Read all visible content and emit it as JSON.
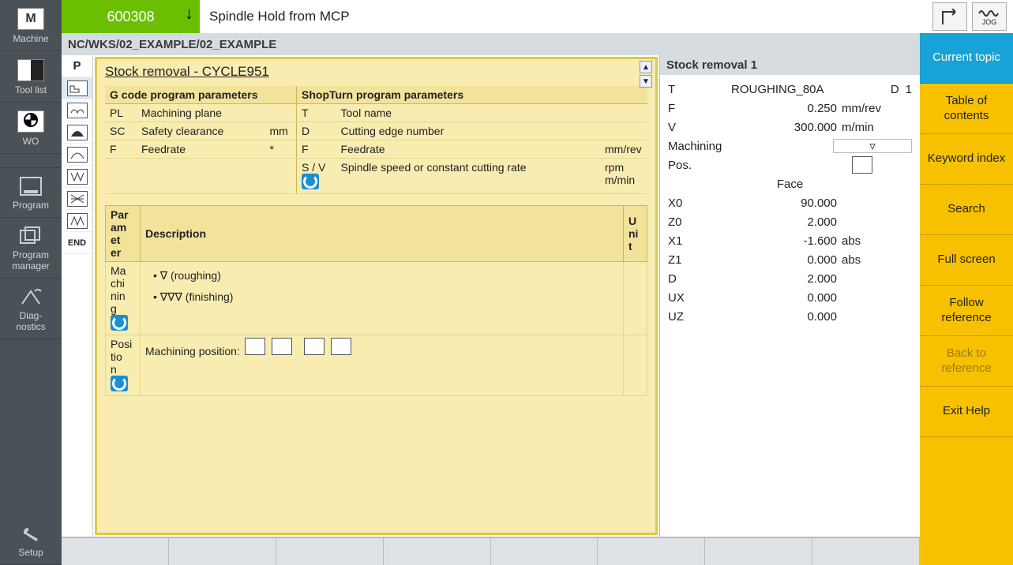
{
  "left_sidebar": {
    "machine": "Machine",
    "toollist": "Tool list",
    "wo": "WO",
    "program": "Program",
    "progman1": "Program",
    "progman2": "manager",
    "diag1": "Diag-",
    "diag2": "nostics",
    "setup": "Setup"
  },
  "top_bar": {
    "alarm_no": "600308",
    "alarm_text": "Spindle Hold from MCP",
    "jog": "JOG"
  },
  "path": "NC/WKS/02_EXAMPLE/02_EXAMPLE",
  "steps": {
    "p": "P",
    "end": "END"
  },
  "help": {
    "title": "Stock removal - CYCLE951",
    "gcode_hdr": "G code program parameters",
    "shopturn_hdr": "ShopTurn program parameters",
    "g1_code": "PL",
    "g1_desc": "Machining plane",
    "g1_unit": "",
    "g2_code": "SC",
    "g2_desc": "Safety clearance",
    "g2_unit": "mm",
    "g3_code": "F",
    "g3_desc": "Feedrate",
    "g3_unit": "*",
    "s1_code": "T",
    "s1_desc": "Tool name",
    "s1_unit": "",
    "s2_code": "D",
    "s2_desc": "Cutting edge number",
    "s2_unit": "",
    "s3_code": "F",
    "s3_desc": "Feedrate",
    "s3_unit": "mm/rev",
    "s4_code": "S / V",
    "s4_desc": "Spindle speed or constant cutting rate",
    "s4_unit1": "rpm",
    "s4_unit2": "m/min",
    "desc_par": "Parameter",
    "desc_desc": "Description",
    "desc_unit": "Unit",
    "machining_label": "Machining",
    "rough": "∇ (roughing)",
    "finish": "∇∇∇ (finishing)",
    "position_label": "Position",
    "machining_pos": "Machining position:"
  },
  "cycle_form": {
    "title": "Stock removal 1",
    "t_lab": "T",
    "t_val": "ROUGHING_80A",
    "d_lab": "D",
    "d_val": "1",
    "f_lab": "F",
    "f_val": "0.250",
    "f_unit": "mm/rev",
    "v_lab": "V",
    "v_val": "300.000",
    "v_unit": "m/min",
    "mach": "Machining",
    "mach_val": "▿",
    "pos": "Pos.",
    "face": "Face",
    "x0_lab": "X0",
    "x0_val": "90.000",
    "z0_lab": "Z0",
    "z0_val": "2.000",
    "x1_lab": "X1",
    "x1_val": "-1.600",
    "x1_unit": "abs",
    "z1_lab": "Z1",
    "z1_val": "0.000",
    "z1_unit": "abs",
    "dd_lab": "D",
    "dd_val": "2.000",
    "ux_lab": "UX",
    "ux_val": "0.000",
    "uz_lab": "UZ",
    "uz_val": "0.000"
  },
  "right_sidebar": {
    "current": "Current topic",
    "toc": "Table of contents",
    "kw": "Keyword index",
    "search": "Search",
    "full": "Full screen",
    "follow": "Follow reference",
    "back": "Back to reference",
    "exit": "Exit Help"
  }
}
